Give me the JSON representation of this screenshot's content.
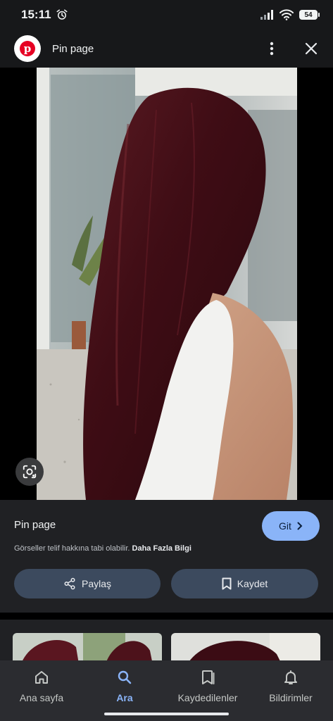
{
  "status": {
    "time": "15:11",
    "battery": "54"
  },
  "header": {
    "title": "Pin page",
    "logo_icon": "pinterest-icon",
    "brand_color": "#e60023"
  },
  "info": {
    "title": "Pin page",
    "visit_label": "Git",
    "copyright_text": "Görseller telif hakkına tabi olabilir.",
    "learn_more": "Daha Fazla Bilgi",
    "share_label": "Paylaş",
    "save_label": "Kaydet",
    "accent": "#8ab4f8"
  },
  "nav": {
    "items": [
      {
        "label": "Ana sayfa",
        "icon": "home-icon"
      },
      {
        "label": "Ara",
        "icon": "search-icon",
        "active": true
      },
      {
        "label": "Kaydedilenler",
        "icon": "collections-icon"
      },
      {
        "label": "Bildirimler",
        "icon": "bell-icon"
      }
    ]
  }
}
